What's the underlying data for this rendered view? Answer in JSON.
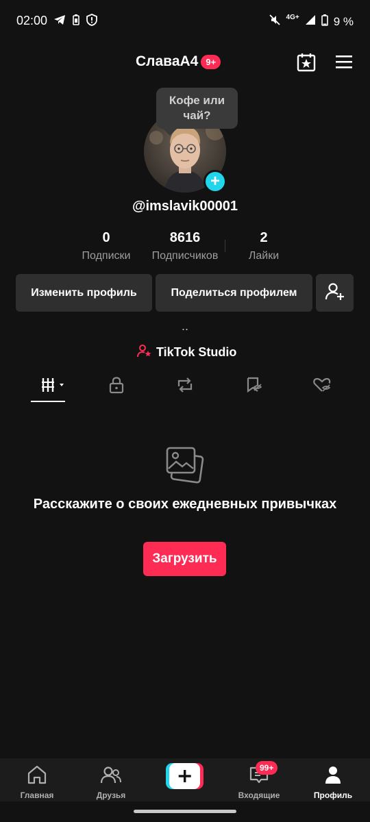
{
  "status_bar": {
    "time": "02:00",
    "network": "4G+",
    "battery": "9 %"
  },
  "header": {
    "title": "СлаваА4",
    "badge": "9+"
  },
  "profile": {
    "tooltip": "Кофе или чай?",
    "username": "@imslavik00001",
    "stats": [
      {
        "value": "0",
        "label": "Подписки"
      },
      {
        "value": "8616",
        "label": "Подписчиков"
      },
      {
        "value": "2",
        "label": "Лайки"
      }
    ],
    "edit_button": "Изменить профиль",
    "share_button": "Поделиться профилем",
    "bio": "..",
    "studio": "TikTok Studio"
  },
  "empty_state": {
    "title": "Расскажите о своих ежедневных привычках",
    "button": "Загрузить"
  },
  "bottom_nav": {
    "items": [
      {
        "label": "Главная"
      },
      {
        "label": "Друзья"
      },
      {
        "label": "Входящие",
        "badge": "99+"
      },
      {
        "label": "Профиль"
      }
    ]
  },
  "colors": {
    "accent": "#fe2c55",
    "cyan": "#20d5ec",
    "background": "#121212"
  }
}
